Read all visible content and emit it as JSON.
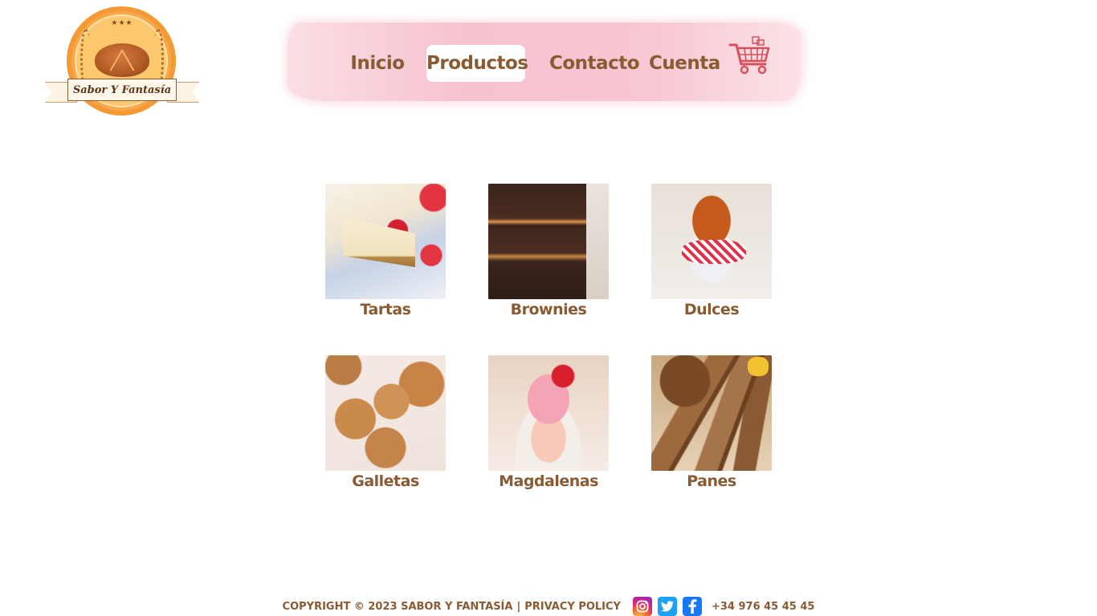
{
  "brand": {
    "logo_text": "Sabor Y Fantasía",
    "logo_stars": "★★★"
  },
  "nav": {
    "items": [
      {
        "label": "Inicio",
        "active": false
      },
      {
        "label": "Productos",
        "active": true
      },
      {
        "label": "Contacto",
        "active": false
      },
      {
        "label": "Cuenta",
        "active": false
      }
    ],
    "cart_icon": "shopping-cart-icon"
  },
  "products": [
    {
      "name": "Tartas",
      "image": "cheesecake-photo"
    },
    {
      "name": "Brownies",
      "image": "brownies-photo"
    },
    {
      "name": "Dulces",
      "image": "candied-nuts-jar-photo"
    },
    {
      "name": "Galletas",
      "image": "cookies-photo"
    },
    {
      "name": "Magdalenas",
      "image": "cupcake-photo"
    },
    {
      "name": "Panes",
      "image": "banana-bread-photo"
    }
  ],
  "footer": {
    "copyright": "COPYRIGHT © 2023 SABOR Y FANTASÍA",
    "separator": "|",
    "privacy": "PRIVACY POLICY",
    "social": [
      {
        "name": "instagram-icon",
        "glyph": "◎"
      },
      {
        "name": "twitter-icon",
        "glyph": "t"
      },
      {
        "name": "facebook-icon",
        "glyph": "f"
      }
    ],
    "phone": "+34 976 45 45 45"
  },
  "colors": {
    "text_brown": "#8a5a32",
    "nav_pink": "#f6c2cf",
    "logo_orange": "#f7a84a",
    "cart_red": "#d9505c"
  }
}
